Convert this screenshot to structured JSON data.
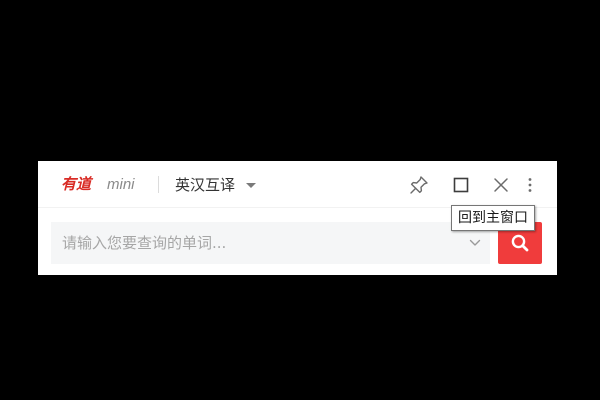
{
  "app": {
    "logo_text": "有道",
    "logo_suffix": "mini",
    "brand_color": "#d92b25"
  },
  "title_bar": {
    "mode_label": "英汉互译",
    "mode_caret_icon": "caret-down-icon",
    "buttons": [
      {
        "name": "pin-icon"
      },
      {
        "name": "maximize-icon"
      },
      {
        "name": "close-icon"
      },
      {
        "name": "more-vertical-icon"
      }
    ]
  },
  "tooltip": {
    "text": "回到主窗口"
  },
  "search": {
    "placeholder": "请输入您要查询的单词...",
    "value": "",
    "history_icon": "chevron-down-icon",
    "button_icon": "search-icon",
    "button_color": "#f03c3c"
  },
  "colors": {
    "background": "#000000",
    "window": "#ffffff",
    "input_bg": "#f5f6f7",
    "icon": "#6b6b6b"
  }
}
